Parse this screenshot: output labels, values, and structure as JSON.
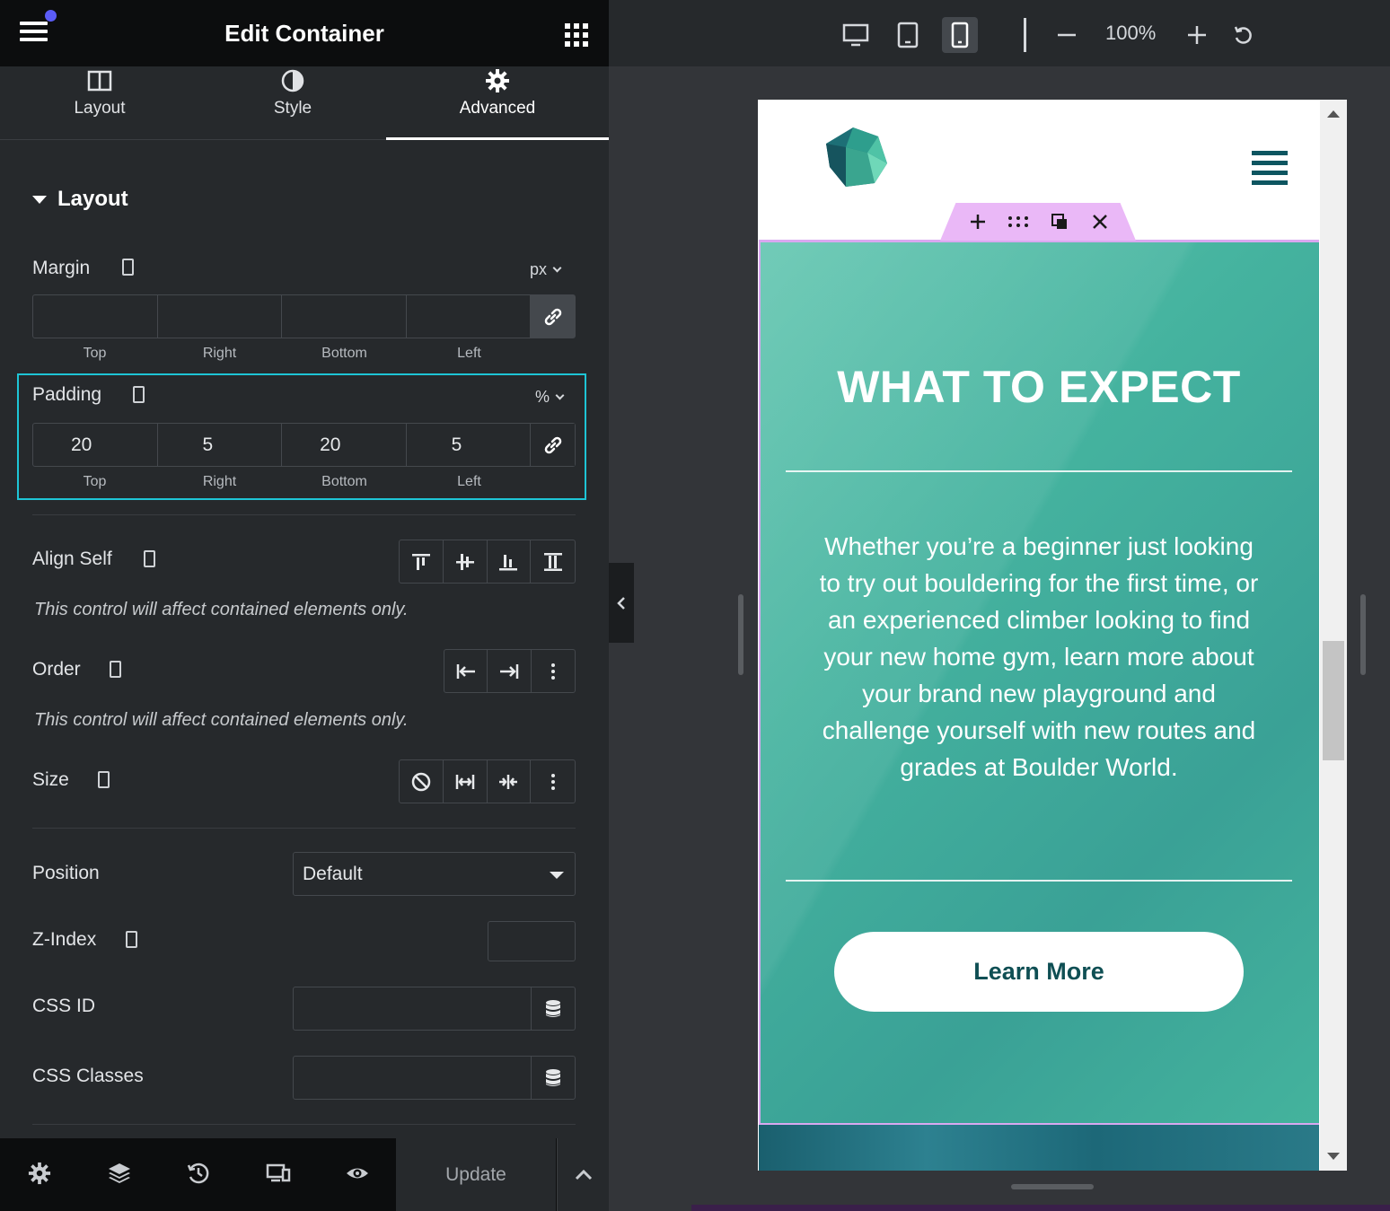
{
  "header": {
    "title": "Edit Container"
  },
  "tabs": [
    {
      "label": "Layout",
      "icon": "columns-icon"
    },
    {
      "label": "Style",
      "icon": "half-circle-icon"
    },
    {
      "label": "Advanced",
      "icon": "gear-icon"
    }
  ],
  "section": {
    "title": "Layout"
  },
  "margin": {
    "label": "Margin",
    "unit": "px",
    "values": [
      "",
      "",
      "",
      ""
    ],
    "sides": [
      "Top",
      "Right",
      "Bottom",
      "Left"
    ]
  },
  "padding": {
    "label": "Padding",
    "unit": "%",
    "values": [
      "20",
      "5",
      "20",
      "5"
    ],
    "sides": [
      "Top",
      "Right",
      "Bottom",
      "Left"
    ]
  },
  "align_self": {
    "label": "Align Self",
    "note": "This control will affect contained elements only."
  },
  "order": {
    "label": "Order",
    "note": "This control will affect contained elements only."
  },
  "size": {
    "label": "Size"
  },
  "position": {
    "label": "Position",
    "value": "Default"
  },
  "z_index": {
    "label": "Z-Index",
    "value": ""
  },
  "css_id": {
    "label": "CSS ID",
    "value": ""
  },
  "css_classes": {
    "label": "CSS Classes",
    "value": ""
  },
  "footer": {
    "update_label": "Update"
  },
  "toolbar": {
    "zoom": "100%"
  },
  "preview": {
    "title": "WHAT TO EXPECT",
    "body": "Whether you’re a beginner just looking to try out bouldering for the first time, or an experienced climber looking to find your new home gym, learn more about your brand new playground and challenge yourself with new routes and grades at Boulder World.",
    "button_label": "Learn More"
  },
  "colors": {
    "accent": "#1ec5d6",
    "teal": "#45b39f",
    "handle": "#eab8f7",
    "notification": "#5b5cf6"
  }
}
